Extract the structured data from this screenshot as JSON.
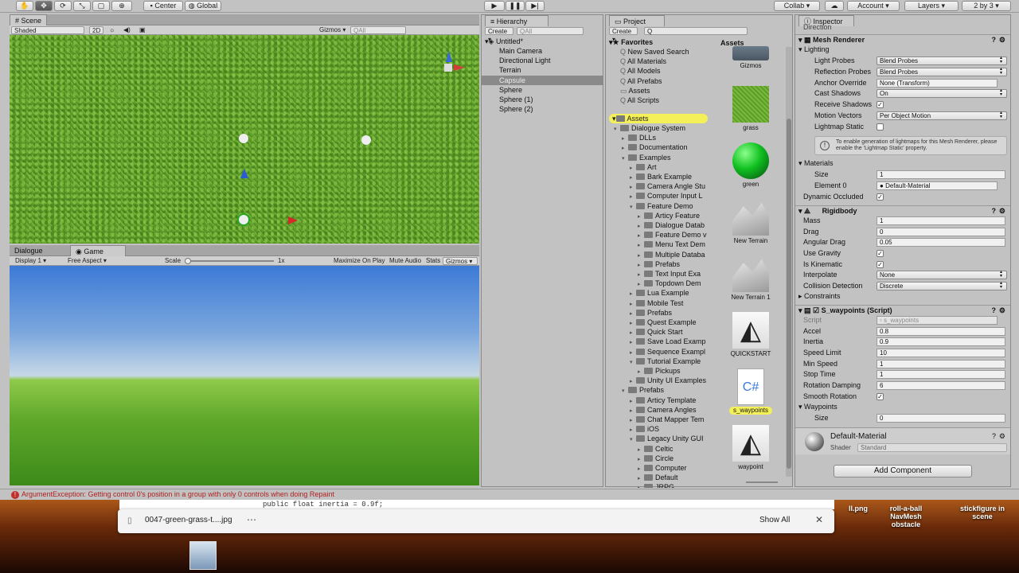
{
  "toolbar": {
    "pivot_center": "Center",
    "pivot_global": "Global",
    "collab": "Collab",
    "account": "Account",
    "layers": "Layers",
    "layout": "2 by 3"
  },
  "scene": {
    "tab": "Scene",
    "shading": "Shaded",
    "mode_2d": "2D",
    "gizmos": "Gizmos",
    "search_placeholder": "All"
  },
  "game": {
    "tab_dialogue": "Dialogue",
    "tab_game": "Game",
    "display": "Display 1",
    "aspect": "Free Aspect",
    "scale_label": "Scale",
    "scale_value": "1x",
    "scale_fraction": 0.0,
    "maximize": "Maximize On Play",
    "mute": "Mute Audio",
    "stats": "Stats",
    "gizmos": "Gizmos"
  },
  "hierarchy": {
    "tab": "Hierarchy",
    "create": "Create",
    "search_placeholder": "All",
    "scene_name": "Untitled*",
    "items": [
      "Main Camera",
      "Directional Light",
      "Terrain",
      "Capsule",
      "Sphere",
      "Sphere (1)",
      "Sphere (2)"
    ],
    "selected": "Capsule"
  },
  "project": {
    "tab": "Project",
    "create": "Create",
    "favorites_label": "Favorites",
    "favorites": [
      "New Saved Search",
      "All Materials",
      "All Models",
      "All Prefabs",
      "Assets",
      "All Scripts"
    ],
    "assets_label": "Assets",
    "tree": [
      {
        "label": "Dialogue System",
        "indent": 1,
        "open": true
      },
      {
        "label": "DLLs",
        "indent": 2,
        "open": false
      },
      {
        "label": "Documentation",
        "indent": 2,
        "open": false
      },
      {
        "label": "Examples",
        "indent": 2,
        "open": true
      },
      {
        "label": "Art",
        "indent": 3,
        "open": false
      },
      {
        "label": "Bark Example",
        "indent": 3,
        "open": false
      },
      {
        "label": "Camera Angle Stu",
        "indent": 3,
        "open": false
      },
      {
        "label": "Computer Input L",
        "indent": 3,
        "open": false
      },
      {
        "label": "Feature Demo",
        "indent": 3,
        "open": true
      },
      {
        "label": "Articy Feature",
        "indent": 4,
        "open": false
      },
      {
        "label": "Dialogue Datab",
        "indent": 4,
        "open": false
      },
      {
        "label": "Feature Demo v",
        "indent": 4,
        "open": false
      },
      {
        "label": "Menu Text Dem",
        "indent": 4,
        "open": false
      },
      {
        "label": "Multiple Databa",
        "indent": 4,
        "open": false
      },
      {
        "label": "Prefabs",
        "indent": 4,
        "open": false
      },
      {
        "label": "Text Input Exa",
        "indent": 4,
        "open": false
      },
      {
        "label": "Topdown Dem",
        "indent": 4,
        "open": false
      },
      {
        "label": "Lua Example",
        "indent": 3,
        "open": false
      },
      {
        "label": "Mobile Test",
        "indent": 3,
        "open": false
      },
      {
        "label": "Prefabs",
        "indent": 3,
        "open": false
      },
      {
        "label": "Quest Example",
        "indent": 3,
        "open": false
      },
      {
        "label": "Quick Start",
        "indent": 3,
        "open": false
      },
      {
        "label": "Save Load Examp",
        "indent": 3,
        "open": false
      },
      {
        "label": "Sequence Exampl",
        "indent": 3,
        "open": false
      },
      {
        "label": "Tutorial Example",
        "indent": 3,
        "open": true
      },
      {
        "label": "Pickups",
        "indent": 4,
        "open": false
      },
      {
        "label": "Unity UI Examples",
        "indent": 3,
        "open": false
      },
      {
        "label": "Prefabs",
        "indent": 2,
        "open": true
      },
      {
        "label": "Articy Template",
        "indent": 3,
        "open": false
      },
      {
        "label": "Camera Angles",
        "indent": 3,
        "open": false
      },
      {
        "label": "Chat Mapper Tem",
        "indent": 3,
        "open": false
      },
      {
        "label": "iOS",
        "indent": 3,
        "open": false
      },
      {
        "label": "Legacy Unity GUI",
        "indent": 3,
        "open": true
      },
      {
        "label": "Celtic",
        "indent": 4,
        "open": false
      },
      {
        "label": "Circle",
        "indent": 4,
        "open": false
      },
      {
        "label": "Computer",
        "indent": 4,
        "open": false
      },
      {
        "label": "Default",
        "indent": 4,
        "open": false
      },
      {
        "label": "JRPG",
        "indent": 4,
        "open": false
      }
    ],
    "grid_header": "Assets",
    "grid_items": [
      {
        "label": "Gizmos",
        "kind": "folder"
      },
      {
        "label": "grass",
        "kind": "grass"
      },
      {
        "label": "green",
        "kind": "sphere"
      },
      {
        "label": "New Terrain",
        "kind": "terrain"
      },
      {
        "label": "New Terrain 1",
        "kind": "terrain"
      },
      {
        "label": "QUICKSTART",
        "kind": "unity"
      },
      {
        "label": "s_waypoints",
        "kind": "script"
      },
      {
        "label": "waypoint",
        "kind": "unity"
      }
    ]
  },
  "inspector": {
    "tab": "Inspector",
    "top_cut": "Direction",
    "mesh_renderer": {
      "title": "Mesh Renderer",
      "lighting": "Lighting",
      "light_probes_label": "Light Probes",
      "light_probes": "Blend Probes",
      "reflection_label": "Reflection Probes",
      "reflection": "Blend Probes",
      "anchor_label": "Anchor Override",
      "anchor": "None (Transform)",
      "cast_label": "Cast Shadows",
      "cast": "On",
      "receive_label": "Receive Shadows",
      "motion_label": "Motion Vectors",
      "motion": "Per Object Motion",
      "lightmap_label": "Lightmap Static",
      "info": "To enable generation of lightmaps for this Mesh Renderer, please enable the 'Lightmap Static' property.",
      "materials": "Materials",
      "size_label": "Size",
      "size": "1",
      "element_label": "Element 0",
      "element": "Default-Material",
      "dynamic_label": "Dynamic Occluded"
    },
    "rigidbody": {
      "title": "Rigidbody",
      "mass_label": "Mass",
      "mass": "1",
      "drag_label": "Drag",
      "drag": "0",
      "angular_label": "Angular Drag",
      "angular": "0.05",
      "gravity_label": "Use Gravity",
      "kinematic_label": "Is Kinematic",
      "interpolate_label": "Interpolate",
      "interpolate": "None",
      "collision_label": "Collision Detection",
      "collision": "Discrete",
      "constraints": "Constraints"
    },
    "script": {
      "title": "S_waypoints (Script)",
      "script_label": "Script",
      "script": "s_waypoints",
      "accel_label": "Accel",
      "accel": "0.8",
      "inertia_label": "Inertia",
      "inertia": "0.9",
      "speed_label": "Speed Limit",
      "speed": "10",
      "minspeed_label": "Min Speed",
      "minspeed": "1",
      "stoptime_label": "Stop Time",
      "stoptime": "1",
      "rotdamp_label": "Rotation Damping",
      "rotdamp": "6",
      "smooth_label": "Smooth Rotation",
      "waypoints": "Waypoints",
      "wsize_label": "Size",
      "wsize": "0"
    },
    "material": {
      "title": "Default-Material",
      "shader_label": "Shader",
      "shader": "Standard"
    },
    "add_component": "Add Component"
  },
  "console": {
    "error": "ArgumentException: Getting control 0's position in a group with only 0 controls when doing Repaint"
  },
  "code_peek": "public float inertia = 0.9f;",
  "download": {
    "filename": "0047-green-grass-t....jpg",
    "show_all": "Show All"
  },
  "desktop_icons": [
    {
      "label": "ll.png"
    },
    {
      "label": "roll-a-ball\nNavMesh obstacle"
    },
    {
      "label": "stickfigure in\nscene"
    }
  ],
  "colors": {
    "selection_yellow": "#f3f05a",
    "error_red": "#c0302a",
    "grass": "#5e9c2c",
    "sky": "#3c7ad6"
  }
}
